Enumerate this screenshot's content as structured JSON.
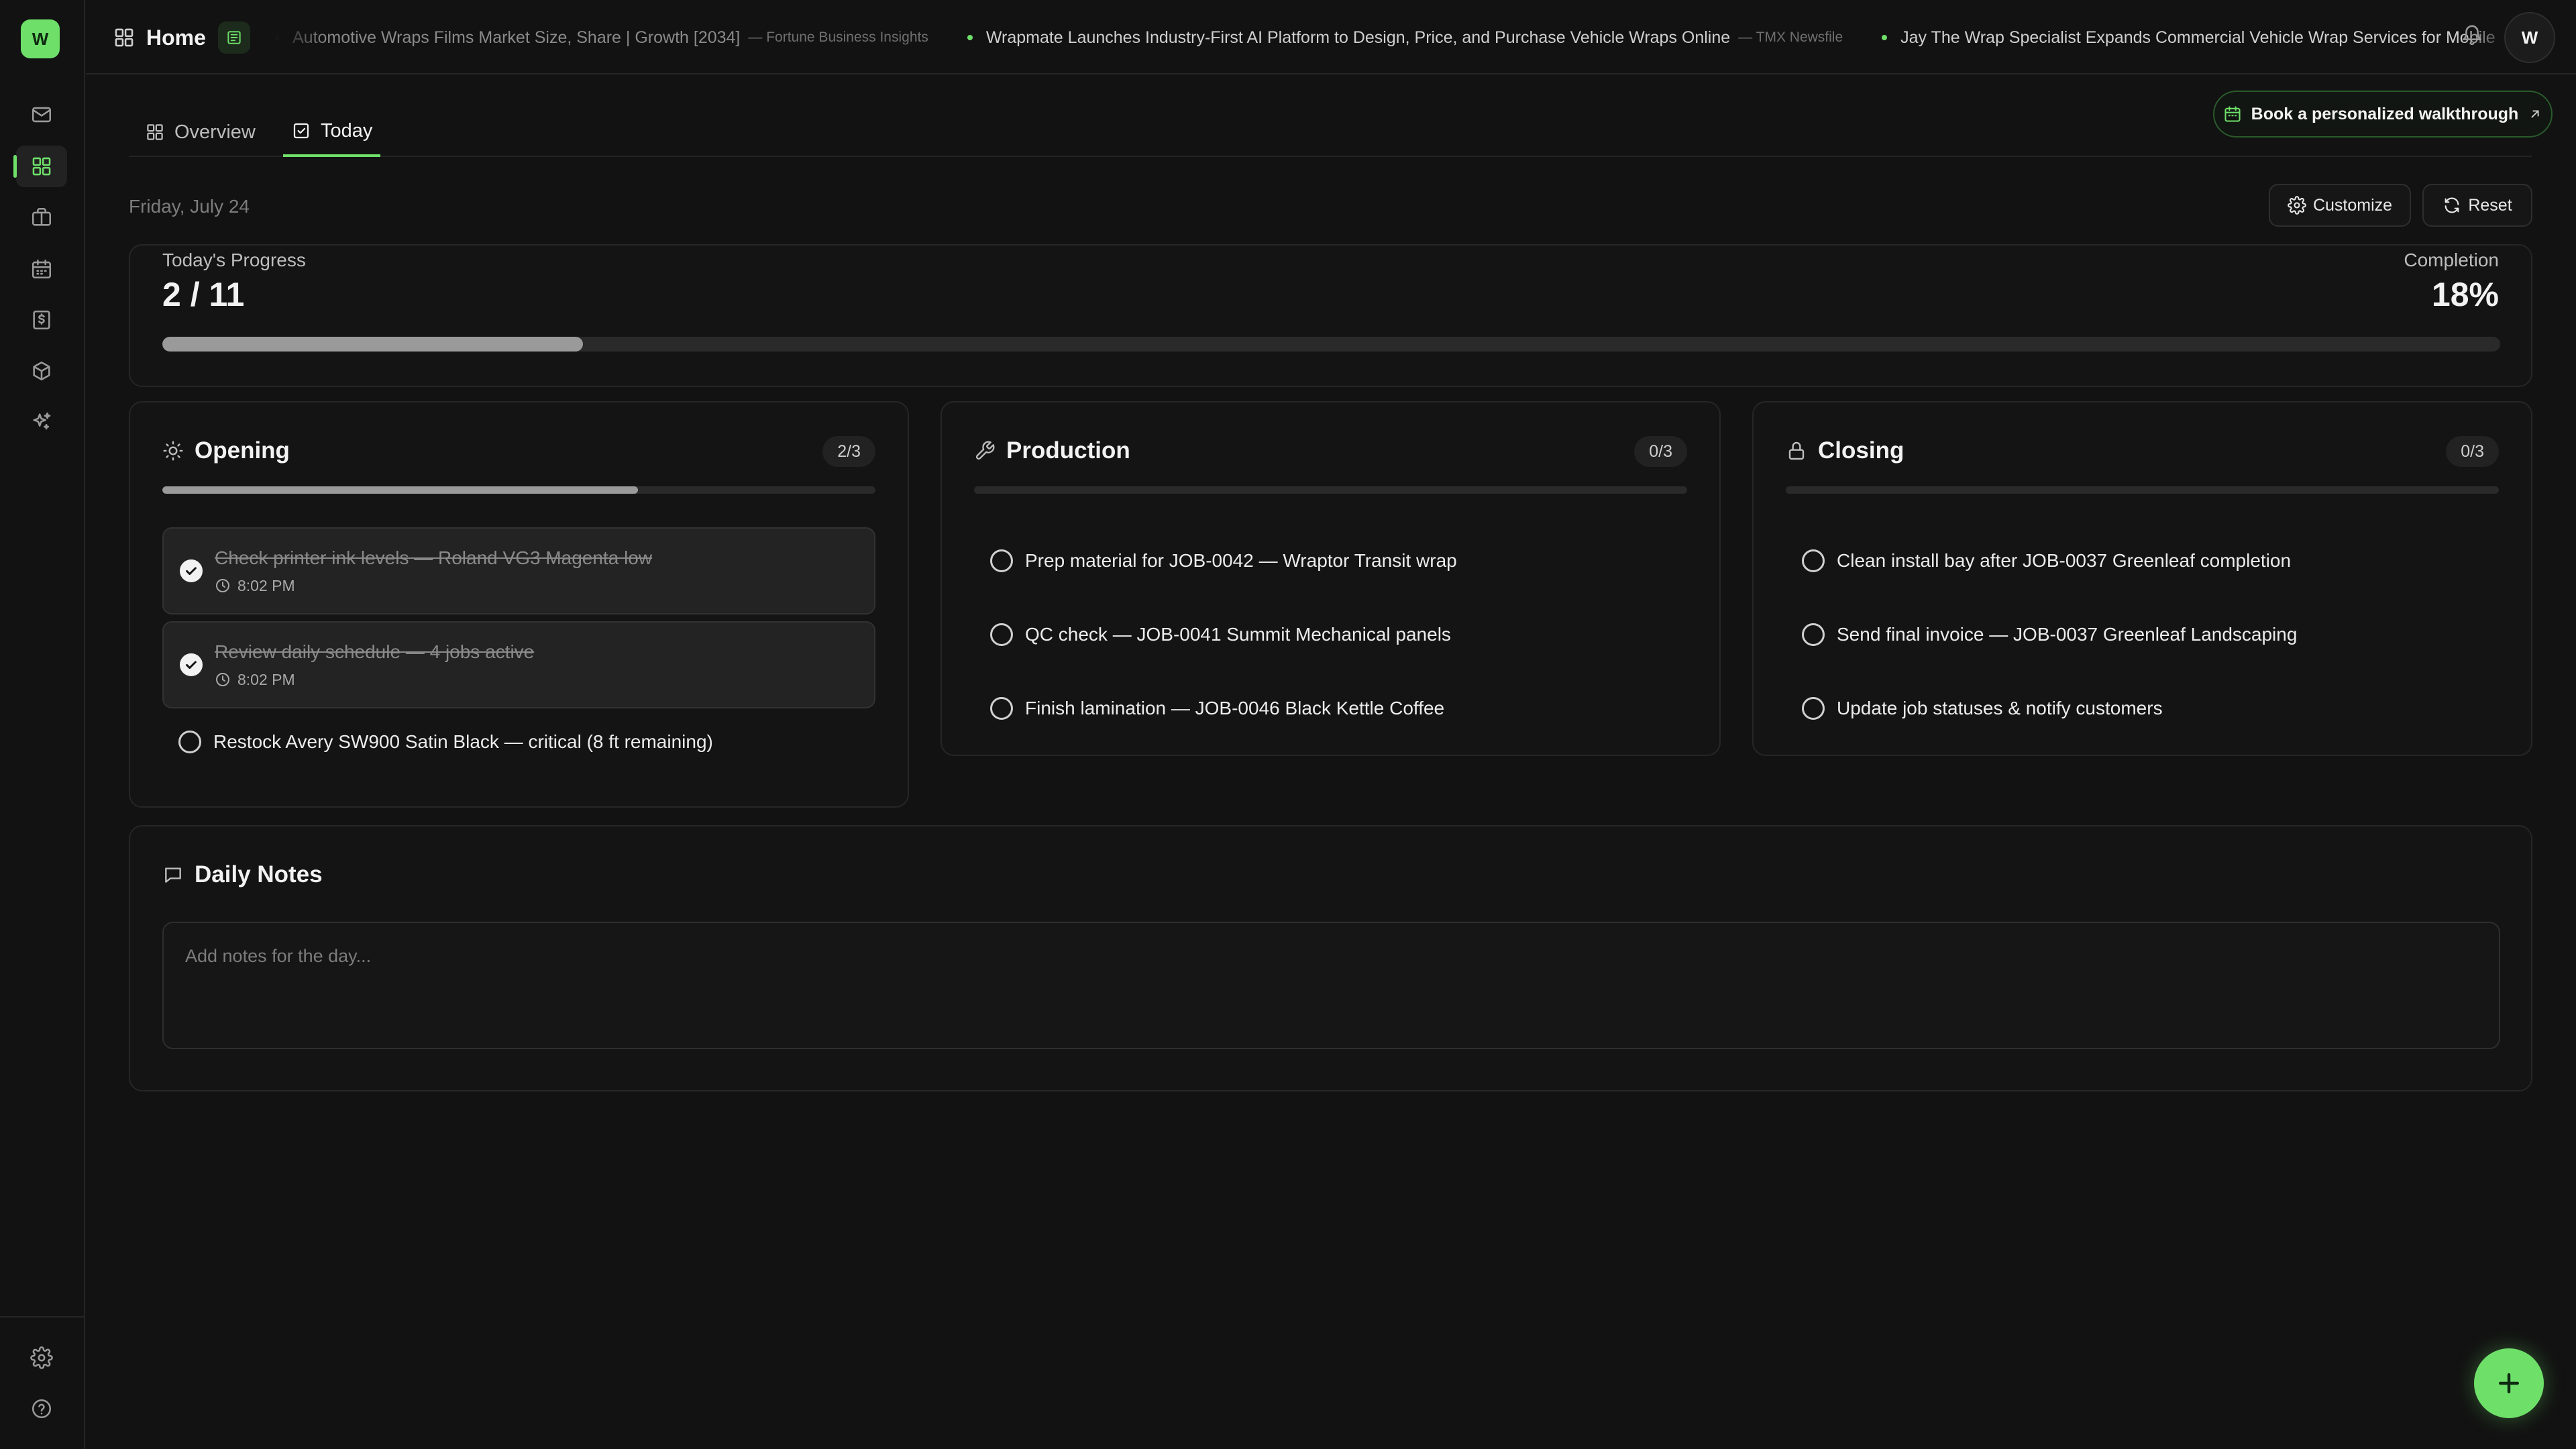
{
  "app": {
    "logo_letter": "W",
    "accent_color": "#6ee06a"
  },
  "sidebar": {
    "items": [
      {
        "name": "mail-icon",
        "active": false
      },
      {
        "name": "dashboard-icon",
        "active": true
      },
      {
        "name": "briefcase-icon",
        "active": false
      },
      {
        "name": "calendar-icon",
        "active": false
      },
      {
        "name": "invoice-icon",
        "active": false
      },
      {
        "name": "box-icon",
        "active": false
      },
      {
        "name": "sparkles-icon",
        "active": false
      }
    ],
    "bottom": [
      {
        "name": "settings-icon"
      },
      {
        "name": "help-icon"
      }
    ]
  },
  "header": {
    "title": "Home",
    "news": [
      {
        "title": "Automotive Wraps Films Market Size, Share | Growth [2034]",
        "source": "— Fortune Business Insights"
      },
      {
        "title": "Wrapmate Launches Industry-First AI Platform to Design, Price, and Purchase Vehicle Wraps Online",
        "source": "— TMX Newsfile"
      },
      {
        "title": "Jay The Wrap Specialist Expands Commercial Vehicle Wrap Services for Mobile",
        "source": ""
      }
    ],
    "avatar_initial": "W"
  },
  "tabs": [
    {
      "label": "Overview",
      "active": false
    },
    {
      "label": "Today",
      "active": true
    }
  ],
  "walkthrough_label": "Book a personalized walkthrough",
  "date": "Friday, July 24",
  "actions": {
    "customize": "Customize",
    "reset": "Reset"
  },
  "progress": {
    "label": "Today's Progress",
    "value": "2 / 11",
    "completion_label": "Completion",
    "completion": "18%",
    "fraction": 0.18
  },
  "sections": [
    {
      "title": "Opening",
      "icon": "sun-icon",
      "count": "2/3",
      "fraction": 0.667,
      "tasks": [
        {
          "text": "Check printer ink levels — Roland VG3 Magenta low",
          "done": true,
          "time": "8:02 PM"
        },
        {
          "text": "Review daily schedule — 4 jobs active",
          "done": true,
          "time": "8:02 PM"
        },
        {
          "text": "Restock Avery SW900 Satin Black — critical (8 ft remaining)",
          "done": false,
          "time": ""
        }
      ]
    },
    {
      "title": "Production",
      "icon": "wrench-icon",
      "count": "0/3",
      "fraction": 0,
      "tasks": [
        {
          "text": "Prep material for JOB-0042 — Wraptor Transit wrap",
          "done": false,
          "time": ""
        },
        {
          "text": "QC check — JOB-0041 Summit Mechanical panels",
          "done": false,
          "time": ""
        },
        {
          "text": "Finish lamination — JOB-0046 Black Kettle Coffee",
          "done": false,
          "time": ""
        }
      ]
    },
    {
      "title": "Closing",
      "icon": "lock-icon",
      "count": "0/3",
      "fraction": 0,
      "tasks": [
        {
          "text": "Clean install bay after JOB-0037 Greenleaf completion",
          "done": false,
          "time": ""
        },
        {
          "text": "Send final invoice — JOB-0037 Greenleaf Landscaping",
          "done": false,
          "time": ""
        },
        {
          "text": "Update job statuses & notify customers",
          "done": false,
          "time": ""
        }
      ]
    }
  ],
  "notes": {
    "title": "Daily Notes",
    "placeholder": "Add notes for the day..."
  }
}
